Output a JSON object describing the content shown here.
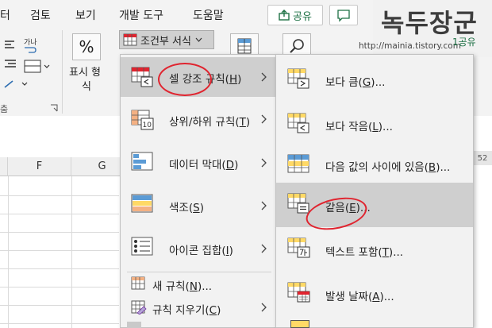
{
  "ribbon": {
    "tabs": [
      "터",
      "검토",
      "보기",
      "개발 도구",
      "도움말"
    ],
    "share_label": "공유",
    "conditional_format_label": "조건부 서식",
    "number_format_label_line1": "표시 형",
    "number_format_label_line2": "식",
    "percent_symbol": "%",
    "side_label": "춤",
    "ganada_label": "가나"
  },
  "watermark": {
    "title": "녹두장군",
    "url": "http://mainia.tistory.com",
    "alt_row": "1공유"
  },
  "sheet": {
    "columns": [
      "F",
      "G"
    ],
    "side_number": "52"
  },
  "menu_main": {
    "items": [
      {
        "label": "셀 강조 규칙(",
        "key": "H",
        "suffix": ")",
        "icon": "highlight-cells-icon",
        "arrow": true
      },
      {
        "label": "상위/하위 규칙(",
        "key": "T",
        "suffix": ")",
        "icon": "top-bottom-icon",
        "arrow": true
      },
      {
        "label": "데이터 막대(",
        "key": "D",
        "suffix": ")",
        "icon": "data-bars-icon",
        "arrow": true
      },
      {
        "label": "색조(",
        "key": "S",
        "suffix": ")",
        "icon": "color-scales-icon",
        "arrow": true
      },
      {
        "label": "아이콘 집합(",
        "key": "I",
        "suffix": ")",
        "icon": "icon-sets-icon",
        "arrow": true
      },
      {
        "label": "새 규칙(",
        "key": "N",
        "suffix": ")...",
        "icon": "new-rule-icon",
        "arrow": false
      },
      {
        "label": "규칙 지우기(",
        "key": "C",
        "suffix": ")",
        "icon": "clear-rules-icon",
        "arrow": true
      }
    ]
  },
  "menu_sub": {
    "items": [
      {
        "label": "보다 큼(",
        "key": "G",
        "suffix": ")...",
        "icon": "greater-than-icon"
      },
      {
        "label": "보다 작음(",
        "key": "L",
        "suffix": ")...",
        "icon": "less-than-icon"
      },
      {
        "label": "다음 값의 사이에 있음(",
        "key": "B",
        "suffix": ")...",
        "icon": "between-icon"
      },
      {
        "label": "같음(",
        "key": "E",
        "suffix": ")...",
        "icon": "equal-to-icon"
      },
      {
        "label": "텍스트 포함(",
        "key": "T",
        "suffix": ")...",
        "icon": "text-contains-icon"
      },
      {
        "label": "발생 날짜(",
        "key": "A",
        "suffix": ")...",
        "icon": "date-occurring-icon"
      }
    ]
  },
  "colors": {
    "accent_green": "#1e7145",
    "highlight_red": "#e0242f",
    "menu_hover": "#cfcfcf"
  }
}
